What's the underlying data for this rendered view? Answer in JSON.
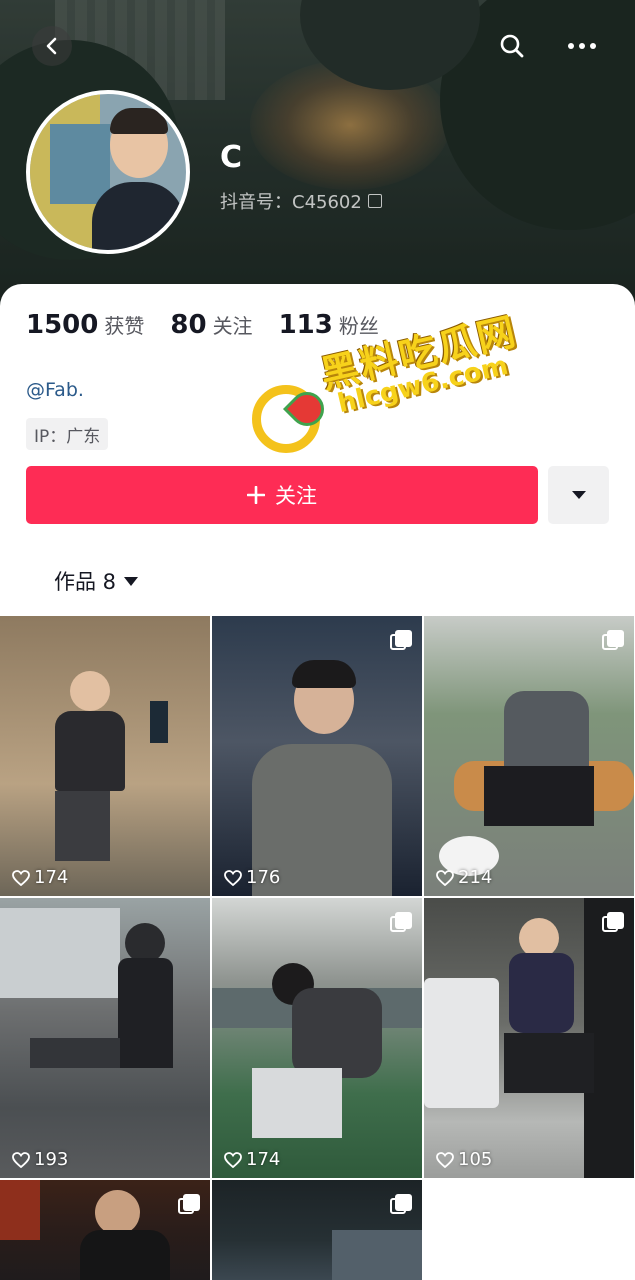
{
  "header": {
    "nickname": "C",
    "douyin_id": "抖音号：C45602"
  },
  "stats": [
    {
      "num": "1500",
      "label": "获赞"
    },
    {
      "num": "80",
      "label": "关注"
    },
    {
      "num": "113",
      "label": "粉丝"
    }
  ],
  "bio": "@Fab.",
  "ip": "IP：广东",
  "follow_label": "关注",
  "works_tab": "作品 8",
  "watermark": {
    "title": "黑料吃瓜网",
    "url": "hlcgw6.com"
  },
  "posts": [
    {
      "likes": "174",
      "multi": false
    },
    {
      "likes": "176",
      "multi": true
    },
    {
      "likes": "214",
      "multi": true
    },
    {
      "likes": "193",
      "multi": false
    },
    {
      "likes": "174",
      "multi": true
    },
    {
      "likes": "105",
      "multi": true
    },
    {
      "likes": "",
      "multi": true
    },
    {
      "likes": "",
      "multi": true
    }
  ],
  "colors": {
    "accent": "#fe2c55",
    "link": "#2b5a8a"
  },
  "icons": [
    "back-icon",
    "search-icon",
    "more-icon",
    "copy-icon",
    "plus-icon",
    "chevron-down-icon",
    "heart-icon",
    "multi-image-icon"
  ]
}
